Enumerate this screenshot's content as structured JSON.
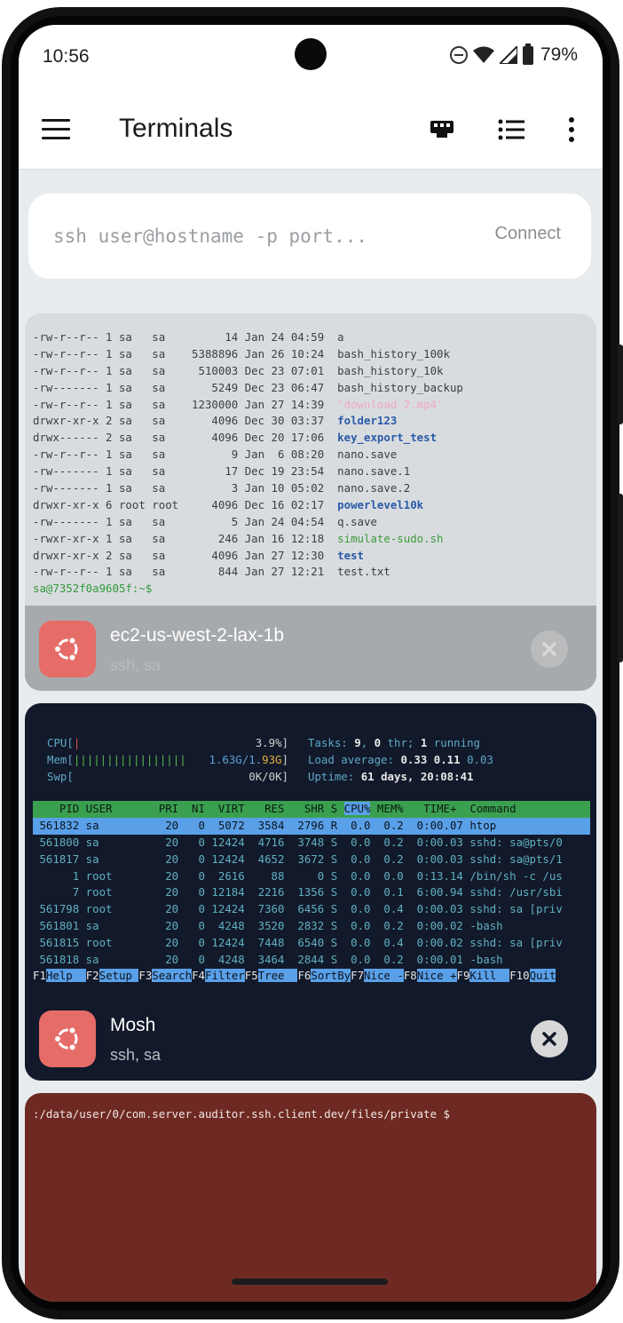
{
  "status_bar": {
    "time": "10:56",
    "battery": "79%"
  },
  "app_bar": {
    "title": "Terminals"
  },
  "connect": {
    "placeholder": "ssh user@hostname -p port...",
    "button": "Connect"
  },
  "card1": {
    "ls_lines": [
      {
        "perm": "-rw-r--r--",
        "links": "1",
        "user": "sa",
        "group": "sa",
        "size": "14",
        "date": "Jan 24 04:59",
        "name": "a",
        "type": "file"
      },
      {
        "perm": "-rw-r--r--",
        "links": "1",
        "user": "sa",
        "group": "sa",
        "size": "5388896",
        "date": "Jan 26 10:24",
        "name": "bash_history_100k",
        "type": "file"
      },
      {
        "perm": "-rw-r--r--",
        "links": "1",
        "user": "sa",
        "group": "sa",
        "size": "510003",
        "date": "Dec 23 07:01",
        "name": "bash_history_10k",
        "type": "file"
      },
      {
        "perm": "-rw-------",
        "links": "1",
        "user": "sa",
        "group": "sa",
        "size": "5249",
        "date": "Dec 23 06:47",
        "name": "bash_history_backup",
        "type": "file"
      },
      {
        "perm": "-rw-r--r--",
        "links": "1",
        "user": "sa",
        "group": "sa",
        "size": "1230000",
        "date": "Jan 27 14:39",
        "name": "'download 2.mp4'",
        "type": "media"
      },
      {
        "perm": "drwxr-xr-x",
        "links": "2",
        "user": "sa",
        "group": "sa",
        "size": "4096",
        "date": "Dec 30 03:37",
        "name": "folder123",
        "type": "dir"
      },
      {
        "perm": "drwx------",
        "links": "2",
        "user": "sa",
        "group": "sa",
        "size": "4096",
        "date": "Dec 20 17:06",
        "name": "key_export_test",
        "type": "dir"
      },
      {
        "perm": "-rw-r--r--",
        "links": "1",
        "user": "sa",
        "group": "sa",
        "size": "9",
        "date": "Jan  6 08:20",
        "name": "nano.save",
        "type": "file"
      },
      {
        "perm": "-rw-------",
        "links": "1",
        "user": "sa",
        "group": "sa",
        "size": "17",
        "date": "Dec 19 23:54",
        "name": "nano.save.1",
        "type": "file"
      },
      {
        "perm": "-rw-------",
        "links": "1",
        "user": "sa",
        "group": "sa",
        "size": "3",
        "date": "Jan 10 05:02",
        "name": "nano.save.2",
        "type": "file"
      },
      {
        "perm": "drwxr-xr-x",
        "links": "6",
        "user": "root",
        "group": "root",
        "size": "4096",
        "date": "Dec 16 02:17",
        "name": "powerlevel10k",
        "type": "dir"
      },
      {
        "perm": "-rw-------",
        "links": "1",
        "user": "sa",
        "group": "sa",
        "size": "5",
        "date": "Jan 24 04:54",
        "name": "q.save",
        "type": "file"
      },
      {
        "perm": "-rwxr-xr-x",
        "links": "1",
        "user": "sa",
        "group": "sa",
        "size": "246",
        "date": "Jan 16 12:18",
        "name": "simulate-sudo.sh",
        "type": "exe"
      },
      {
        "perm": "drwxr-xr-x",
        "links": "2",
        "user": "sa",
        "group": "sa",
        "size": "4096",
        "date": "Jan 27 12:30",
        "name": "test",
        "type": "dir"
      },
      {
        "perm": "-rw-r--r--",
        "links": "1",
        "user": "sa",
        "group": "sa",
        "size": "844",
        "date": "Jan 27 12:21",
        "name": "test.txt",
        "type": "file"
      }
    ],
    "prompt": "sa@7352f0a9605f:~$",
    "host": "ec2-us-west-2-lax-1b",
    "sub": "ssh, sa"
  },
  "card2": {
    "htop": {
      "cpu_label": "CPU[",
      "cpu_bar": "|",
      "cpu_val": "3.9%]",
      "mem_label": "Mem[",
      "mem_bar": "|||||||||||||||||",
      "mem_val_a": "1.63G/1.",
      "mem_val_b": "93G",
      "mem_val_c": "]",
      "swp_label": "Swp[",
      "swp_val": "0K/0K]",
      "tasks_label": "Tasks: ",
      "tasks_val": "9",
      "tasks_sep": ", ",
      "thr_val": "0",
      "thr_label": " thr; ",
      "running_val": "1",
      "running_label": " running",
      "load_label": "Load average: ",
      "load_1": "0.33",
      "load_5": "0.11",
      "load_15": "0.03",
      "uptime_label": "Uptime: ",
      "uptime_val": "61 days, 20:08:41",
      "header_a": "    PID USER       PRI  NI  VIRT   RES   SHR S ",
      "header_cpu": "CPU%",
      "header_b": " MEM%   TIME+  Command        ",
      "rows": [
        " 561832 sa          20   0  5072  3584  2796 R  0.0  0.2  0:00.07 htop           ",
        " 561800 sa          20   0 12424  4716  3748 S  0.0  0.2  0:00.03 sshd: sa@pts/0",
        " 561817 sa          20   0 12424  4652  3672 S  0.0  0.2  0:00.03 sshd: sa@pts/1",
        "      1 root        20   0  2616    88     0 S  0.0  0.0  0:13.14 /bin/sh -c /us",
        "      7 root        20   0 12184  2216  1356 S  0.0  0.1  6:00.94 sshd: /usr/sbi",
        " 561798 root        20   0 12424  7360  6456 S  0.0  0.4  0:00.03 sshd: sa [priv",
        " 561801 sa          20   0  4248  3520  2832 S  0.0  0.2  0:00.02 -bash",
        " 561815 root        20   0 12424  7448  6540 S  0.0  0.4  0:00.02 sshd: sa [priv",
        " 561818 sa          20   0  4248  3464  2844 S  0.0  0.2  0:00.01 -bash"
      ],
      "fkeys": [
        {
          "k": "F1",
          "l": "Help  "
        },
        {
          "k": "F2",
          "l": "Setup "
        },
        {
          "k": "F3",
          "l": "Search"
        },
        {
          "k": "F4",
          "l": "Filter"
        },
        {
          "k": "F5",
          "l": "Tree  "
        },
        {
          "k": "F6",
          "l": "SortBy"
        },
        {
          "k": "F7",
          "l": "Nice -"
        },
        {
          "k": "F8",
          "l": "Nice +"
        },
        {
          "k": "F9",
          "l": "Kill  "
        },
        {
          "k": "F10",
          "l": "Quit"
        }
      ]
    },
    "host": "Mosh",
    "sub": "ssh, sa"
  },
  "card3": {
    "line": ":/data/user/0/com.server.auditor.ssh.client.dev/files/private $"
  },
  "colors": {
    "accent_red": "#e66c68",
    "mosh_bg": "#12192a",
    "local_bg": "#6e2a22"
  }
}
